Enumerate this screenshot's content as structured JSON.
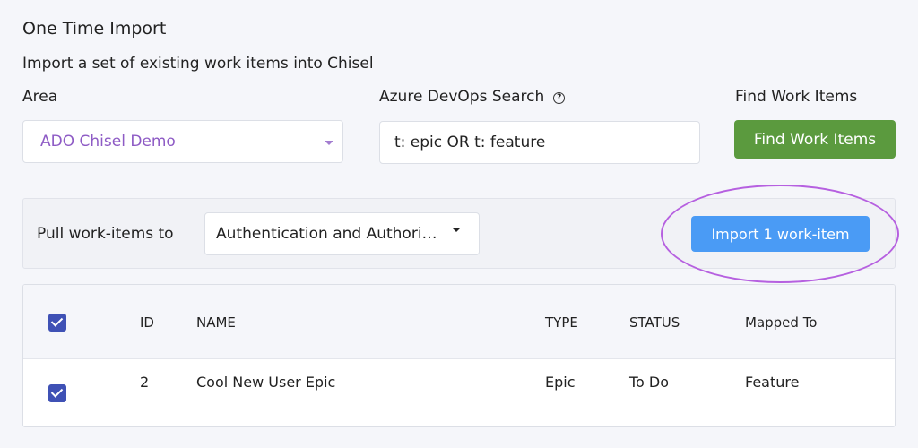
{
  "page": {
    "title": "One Time Import",
    "subtitle": "Import a set of existing work items into Chisel"
  },
  "area": {
    "label": "Area",
    "selected": "ADO Chisel Demo"
  },
  "search": {
    "label": "Azure DevOps Search",
    "help_icon": "question-circle-icon",
    "value": "t: epic OR t: feature"
  },
  "find": {
    "label": "Find Work Items",
    "button_label": "Find Work Items"
  },
  "pull": {
    "label": "Pull work-items to",
    "selected": "Authentication and Authorization",
    "import_button_label": "Import 1 work-item"
  },
  "table": {
    "headers": {
      "id": "ID",
      "name": "NAME",
      "type": "TYPE",
      "status": "STATUS",
      "mapped_to": "Mapped To"
    },
    "rows": [
      {
        "id": "2",
        "name": "Cool New User Epic",
        "type": "Epic",
        "status": "To Do",
        "mapped_to": "Feature",
        "checked": true
      }
    ],
    "select_all_checked": true
  },
  "colors": {
    "primary_button": "#4a9bf5",
    "find_button": "#5b9a3e",
    "checkbox": "#3f51b5",
    "area_text": "#8e5bc5",
    "highlight_ring": "#b660e0"
  }
}
